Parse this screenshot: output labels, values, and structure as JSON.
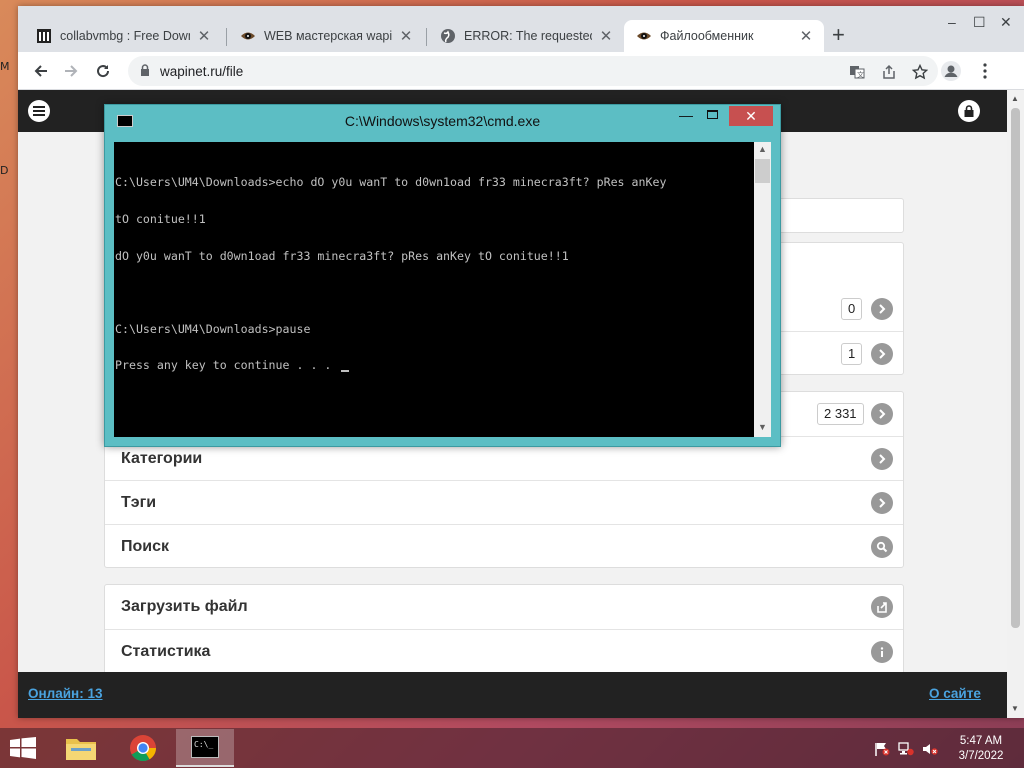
{
  "desktop": {
    "left_fragments": [
      "M",
      "D"
    ]
  },
  "browser": {
    "tabs": [
      {
        "title": "collabvmbg : Free Downl",
        "icon": "archive-icon",
        "active": false
      },
      {
        "title": "WEB мастерская wapinet",
        "icon": "eye-icon",
        "active": false
      },
      {
        "title": "ERROR: The requested U",
        "icon": "globe-icon",
        "active": false
      },
      {
        "title": "Файлообменник",
        "icon": "eye-icon",
        "active": true
      }
    ],
    "new_tab_label": "+",
    "url": "wapinet.ru/file",
    "window_controls": {
      "minimize": "–",
      "maximize": "☐",
      "close": "✕"
    }
  },
  "site": {
    "rows": [
      {
        "label": "Категории"
      },
      {
        "label": "Тэги"
      },
      {
        "label": "Поиск"
      }
    ],
    "counts": [
      "0",
      "1",
      "2 331"
    ],
    "rows2": [
      {
        "label": "Загрузить файл"
      },
      {
        "label": "Статистика"
      }
    ],
    "footer": {
      "online": "Онлайн: 13",
      "about": "О сайте"
    }
  },
  "cmd": {
    "title": "C:\\Windows\\system32\\cmd.exe",
    "lines": [
      "C:\\Users\\UM4\\Downloads>echo dO y0u wanT to d0wn1oad fr33 minecra3ft? pRes anKey",
      "tO conitue!!1",
      "dO y0u wanT to d0wn1oad fr33 minecra3ft? pRes anKey tO conitue!!1",
      "",
      "C:\\Users\\UM4\\Downloads>pause",
      "Press any key to continue . . . "
    ]
  },
  "taskbar": {
    "time": "5:47 AM",
    "date": "3/7/2022"
  }
}
